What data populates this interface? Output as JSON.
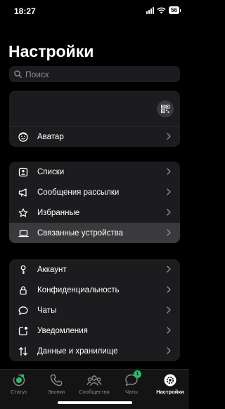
{
  "status_bar": {
    "time": "18:27",
    "battery": "56"
  },
  "title": "Настройки",
  "search": {
    "placeholder": "Поиск"
  },
  "profile": {
    "qr_icon": "qr-code-icon"
  },
  "group1": [
    {
      "label": "Аватар",
      "icon": "avatar-icon"
    }
  ],
  "group2": [
    {
      "label": "Списки",
      "icon": "lists-icon"
    },
    {
      "label": "Сообщения рассылки",
      "icon": "megaphone-icon"
    },
    {
      "label": "Избранные",
      "icon": "star-icon"
    },
    {
      "label": "Связанные устройства",
      "icon": "laptop-icon"
    }
  ],
  "group3": [
    {
      "label": "Аккаунт",
      "icon": "key-icon"
    },
    {
      "label": "Конфиденциальность",
      "icon": "lock-icon"
    },
    {
      "label": "Чаты",
      "icon": "chat-bubble-icon"
    },
    {
      "label": "Уведомления",
      "icon": "notification-icon"
    },
    {
      "label": "Данные и хранилище",
      "icon": "arrows-icon"
    }
  ],
  "tabs": [
    {
      "label": "Статус",
      "icon": "status-icon"
    },
    {
      "label": "Звонки",
      "icon": "phone-icon"
    },
    {
      "label": "Сообщества",
      "icon": "communities-icon"
    },
    {
      "label": "Чаты",
      "icon": "chats-icon",
      "badge": "1"
    },
    {
      "label": "Настройки",
      "icon": "settings-gear-icon",
      "active": true
    }
  ],
  "colors": {
    "accent": "#21c063",
    "card": "#1c1c1e",
    "highlight": "#3a3a3c"
  }
}
